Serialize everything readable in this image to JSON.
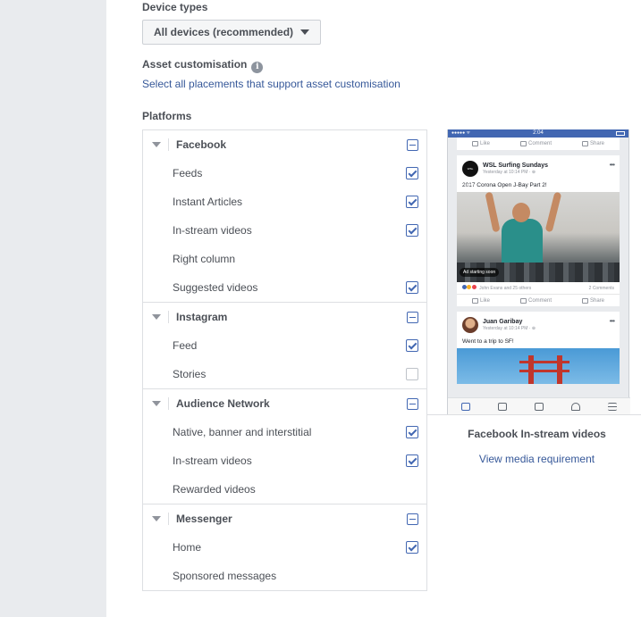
{
  "device_types": {
    "label": "Device types",
    "selected": "All devices (recommended)"
  },
  "asset_customisation": {
    "label": "Asset customisation",
    "link": "Select all placements that support asset customisation"
  },
  "platforms": {
    "label": "Platforms",
    "groups": [
      {
        "name": "Facebook",
        "items": [
          {
            "label": "Feeds",
            "checked": true
          },
          {
            "label": "Instant Articles",
            "checked": true
          },
          {
            "label": "In-stream videos",
            "checked": true
          },
          {
            "label": "Right column",
            "checked": false
          },
          {
            "label": "Suggested videos",
            "checked": true
          }
        ]
      },
      {
        "name": "Instagram",
        "items": [
          {
            "label": "Feed",
            "checked": true
          },
          {
            "label": "Stories",
            "checked": false
          }
        ]
      },
      {
        "name": "Audience Network",
        "items": [
          {
            "label": "Native, banner and interstitial",
            "checked": true
          },
          {
            "label": "In-stream videos",
            "checked": true
          },
          {
            "label": "Rewarded videos",
            "checked": false
          }
        ]
      },
      {
        "name": "Messenger",
        "items": [
          {
            "label": "Home",
            "checked": true
          },
          {
            "label": "Sponsored messages",
            "checked": false
          }
        ]
      }
    ]
  },
  "preview": {
    "status_time": "2:04",
    "status_signal": "●●●●● ᯤ",
    "action_like": "Like",
    "action_comment": "Comment",
    "action_share": "Share",
    "post1": {
      "page_name": "WSL Surfing Sundays",
      "time": "Yesterday at 10:14 PM · ⊕",
      "text": "2017 Corona Open J-Bay Part 2!",
      "avatar_text": "WSL SURFING SUN DAY",
      "ad_badge": "Ad starting soon",
      "reactions_text": "John Evans and 25 others",
      "comments": "2 Comments"
    },
    "post2": {
      "page_name": "Juan Garibay",
      "time": "Yesterday at 10:14 PM · ⊕",
      "text": "Went to a trip to SF!"
    },
    "title": "Facebook In-stream videos",
    "link": "View media requirement"
  }
}
